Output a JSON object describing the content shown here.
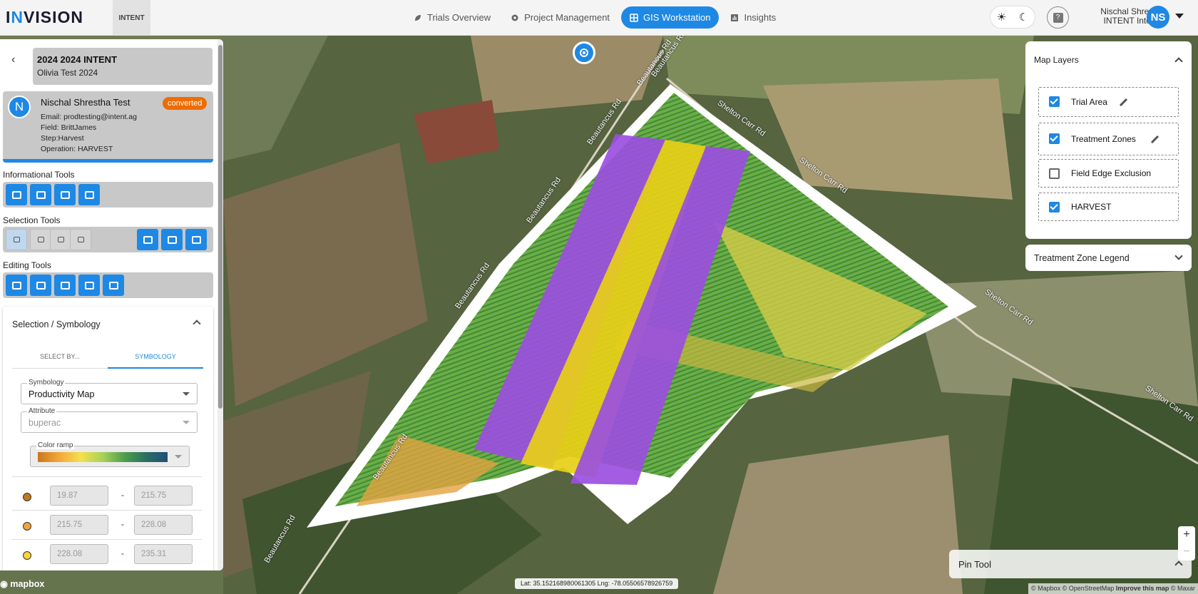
{
  "header": {
    "logo": "INVISION",
    "org_logo": "INTENT",
    "nav": [
      {
        "label": "Trials Overview",
        "icon": "leaf-icon",
        "active": false
      },
      {
        "label": "Project Management",
        "icon": "gear-icon",
        "active": false
      },
      {
        "label": "GIS Workstation",
        "icon": "grid-icon",
        "active": true
      },
      {
        "label": "Insights",
        "icon": "chart-icon",
        "active": false
      }
    ],
    "user_name": "Nischal Shrestha",
    "user_org": "INTENT Internal",
    "user_initials": "NS",
    "help": "?"
  },
  "panel": {
    "trial_title": "2024 2024 INTENT",
    "trial_subtitle": "Olivia Test 2024",
    "user_card": {
      "initial": "N",
      "name": "Nischal Shrestha Test",
      "status": "converted",
      "email": "Email: prodtesting@intent.ag",
      "field": "Field: BrittJames",
      "step": "Step:Harvest",
      "operation": "Operation: HARVEST"
    },
    "sections": {
      "informational": "Informational Tools",
      "selection": "Selection Tools",
      "editing": "Editing Tools"
    },
    "symbology_card": {
      "title": "Selection / Symbology",
      "tabs": [
        "SELECT BY...",
        "SYMBOLOGY"
      ],
      "active_tab": "SYMBOLOGY",
      "symbology_label": "Symbology",
      "symbology_value": "Productivity Map",
      "attribute_label": "Attribute",
      "attribute_value": "buperac",
      "color_ramp_label": "Color ramp",
      "ranges": [
        {
          "color": "#c07a1e",
          "min": "19.87",
          "max": "215.75"
        },
        {
          "color": "#f0a33a",
          "min": "215.75",
          "max": "228.08"
        },
        {
          "color": "#f6d43e",
          "min": "228.08",
          "max": "235.31"
        }
      ],
      "dash": "-"
    }
  },
  "map_layers": {
    "title": "Map Layers",
    "layers": [
      {
        "name": "Trial Area",
        "checked": true,
        "editable": true
      },
      {
        "name": "Treatment Zones",
        "checked": true,
        "editable": true
      },
      {
        "name": "Field Edge Exclusion",
        "checked": false,
        "editable": false
      },
      {
        "name": "HARVEST",
        "checked": true,
        "editable": false
      }
    ]
  },
  "legend": {
    "title": "Treatment Zone Legend"
  },
  "pin_tool": {
    "title": "Pin Tool"
  },
  "map": {
    "coords": "Lat: 35.152168980061305 Lng: -78.05506578926759",
    "brand": "mapbox",
    "attribution_1": "© Mapbox © OpenStreetMap",
    "attribution_2": "Improve this map",
    "attribution_3": "© Maxar",
    "roads": [
      "Beautancus Rd",
      "Beautancus Rd",
      "Beautancus Rd",
      "Beautancus Rd",
      "Beautancus Rd",
      "Beautancus Rd",
      "Beautancus Rd",
      "Shelton Carr Rd",
      "Shelton Carr Rd",
      "Shelton Carr Rd",
      "Shelton Carr Rd"
    ],
    "zoom_in": "+",
    "zoom_out": "−"
  }
}
